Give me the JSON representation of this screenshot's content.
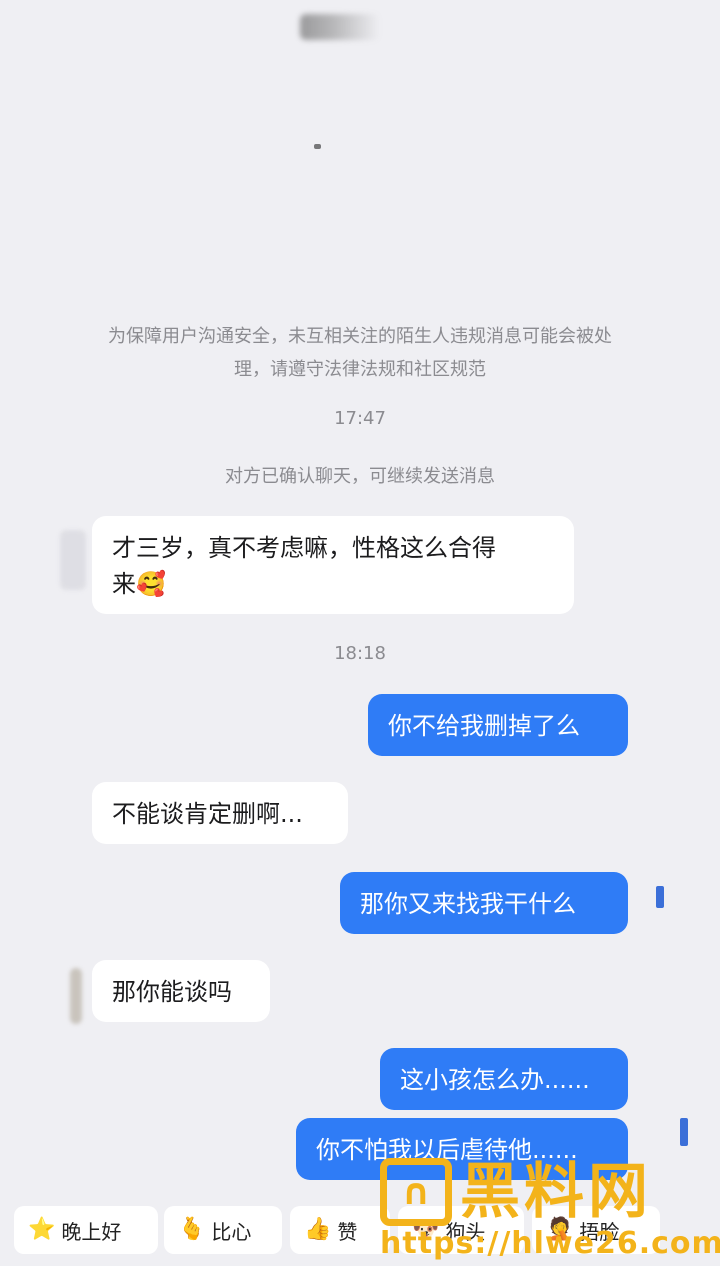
{
  "notice": {
    "line1": "为保障用户沟通安全，未互相关注的陌生人违规消息可能会被处",
    "line2": "理，请遵守法律法规和社区规范"
  },
  "timestamps": [
    "17:47",
    "18:18"
  ],
  "system_msg": "对方已确认聊天，可继续发送消息",
  "messages": [
    {
      "side": "in",
      "text_line1": "才三岁，真不考虑嘛，性格这么合得",
      "text_line2": "来",
      "emoji": "🥰"
    },
    {
      "side": "out",
      "text": "你不给我删掉了么"
    },
    {
      "side": "in",
      "text": "不能谈肯定删啊..."
    },
    {
      "side": "out",
      "text": "那你又来找我干什么"
    },
    {
      "side": "in",
      "text": "那你能谈吗"
    },
    {
      "side": "out",
      "text": "这小孩怎么办......"
    },
    {
      "side": "out",
      "text": "你不怕我以后虐待他......"
    }
  ],
  "quick_replies": [
    {
      "label": "晚上好",
      "icon": "⭐"
    },
    {
      "label": "比心",
      "icon": "🫰"
    },
    {
      "label": "赞",
      "icon": "👍"
    },
    {
      "label": "狗头",
      "icon": "🐶"
    },
    {
      "label": "捂脸",
      "icon": "🤦"
    }
  ],
  "watermark": {
    "logo_char": "∩",
    "title": "黑料网",
    "url": "https://hlwe26.com"
  },
  "colors": {
    "outgoing": "#2f7cf6",
    "incoming": "#ffffff",
    "background": "#efeff3",
    "watermark": "#f3b31a"
  }
}
